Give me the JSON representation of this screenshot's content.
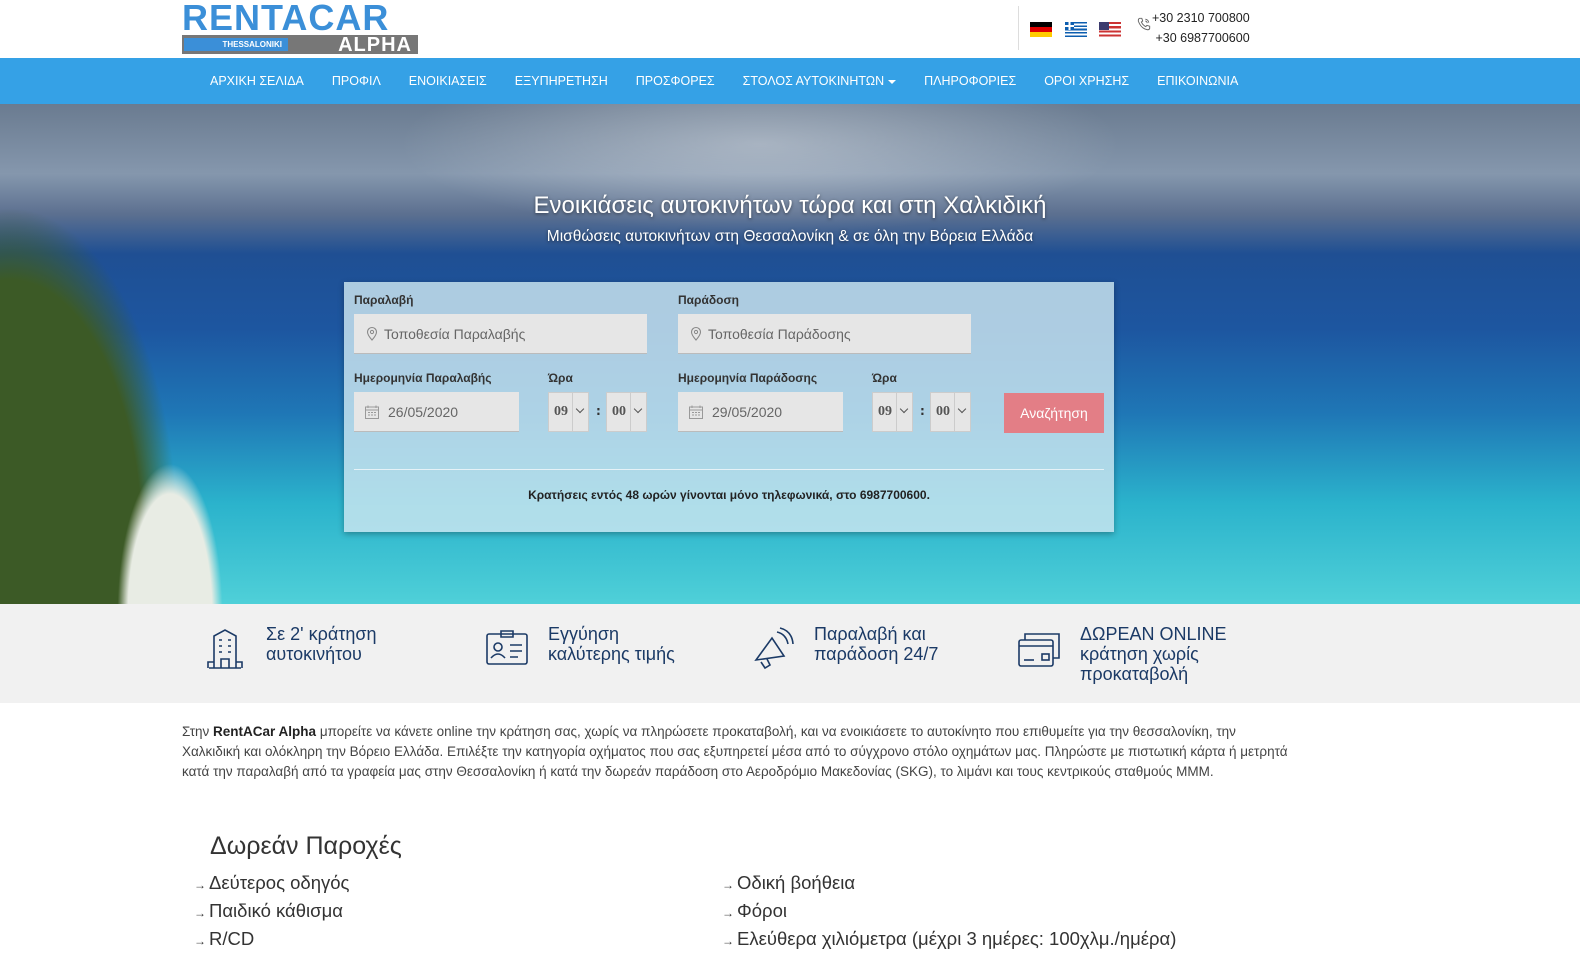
{
  "header": {
    "logo": {
      "top": "RENTACAR",
      "city": "THESSALONIKI",
      "bottom": "ALPHA"
    },
    "flags": [
      "german-flag-icon",
      "greek-flag-icon",
      "us-flag-icon"
    ],
    "phones": [
      "+30 2310 700800",
      "+30 6987700600"
    ]
  },
  "nav": {
    "items": [
      "ΑΡΧΙΚΗ ΣΕΛΙΔΑ",
      "ΠΡΟΦΙΛ",
      "ΕΝΟΙΚΙΑΣΕΙΣ",
      "ΕΞΥΠΗΡΕΤΗΣΗ",
      "ΠΡΟΣΦΟΡΕΣ",
      "ΣΤΟΛΟΣ ΑΥΤΟΚΙΝΗΤΩΝ",
      "ΠΛΗΡΟΦΟΡΙΕΣ",
      "ΟΡΟΙ ΧΡΗΣΗΣ",
      "ΕΠΙΚΟΙΝΩΝΙΑ"
    ]
  },
  "hero": {
    "title": "Ενοικιάσεις αυτοκινήτων τώρα και στη Χαλκιδική",
    "subtitle": "Μισθώσεις αυτοκινήτων στη Θεσσαλονίκη & σε όλη την Βόρεια Ελλάδα"
  },
  "search": {
    "pickup_label": "Παραλαβή",
    "pickup_placeholder": "Τοποθεσία Παραλαβής",
    "dropoff_label": "Παράδοση",
    "dropoff_placeholder": "Τοποθεσία Παράδοσης",
    "pickup_date_label": "Ημερομηνία Παραλαβής",
    "pickup_date": "26/05/2020",
    "time_label": "Ώρα",
    "pickup_hour": "09",
    "pickup_minute": "00",
    "dropoff_date_label": "Ημερομηνία Παράδοσης",
    "dropoff_date": "29/05/2020",
    "dropoff_hour": "09",
    "dropoff_minute": "00",
    "colon": ":",
    "button": "Αναζήτηση",
    "note": "Κρατήσεις εντός 48 ωρών γίνονται μόνο τηλεφωνικά, στο 6987700600."
  },
  "features": [
    {
      "icon": "building-icon",
      "line1": "Σε 2' κράτηση",
      "line2": "αυτοκινήτου",
      "line3": ""
    },
    {
      "icon": "id-card-icon",
      "line1": "Εγγύηση",
      "line2": "καλύτερης τιμής",
      "line3": ""
    },
    {
      "icon": "megaphone-icon",
      "line1": "Παραλαβή και",
      "line2": "παράδοση 24/7",
      "line3": ""
    },
    {
      "icon": "credit-card-icon",
      "line1": "ΔΩΡΕΑΝ ONLINE",
      "line2": "κράτηση χωρίς",
      "line3": "προκαταβολή"
    }
  ],
  "intro": {
    "lead": "Στην ",
    "brand": "RentACar Alpha",
    "text": " μπορείτε να κάνετε online την κράτηση σας, χωρίς να πληρώσετε προκαταβολή, και να ενοικιάσετε το αυτοκίνητο που επιθυμείτε για την θεσσαλονίκη, την Χαλκιδική και ολόκληρη την Βόρειο Ελλάδα. Επιλέξτε την κατηγορία οχήματος που σας εξυπηρετεί μέσα από το σύγχρονο στόλο οχημάτων μας. Πληρώστε με πιστωτική κάρτα ή μετρητά κατά την παραλαβή από τα γραφεία μας στην Θεσσαλονίκη ή κατά την δωρεάν παράδοση στο Αεροδρόμιο Μακεδονίας (SKG), το λιμάνι και τους κεντρικούς σταθμούς ΜΜΜ."
  },
  "free": {
    "title": "Δωρεάν Παροχές",
    "left": [
      "Δεύτερος οδηγός",
      "Παιδικό κάθισμα",
      "R/CD"
    ],
    "right": [
      "Οδική βοήθεια",
      "Φόροι",
      "Ελεύθερα χιλιόμετρα (μέχρι 3 ημέρες: 100χλμ./ημέρα)"
    ]
  },
  "colors": {
    "nav": "#35a1e6",
    "accent_button": "#e37e86",
    "feature_text": "#1b3a66",
    "logo_blue": "#3b8fd8"
  }
}
